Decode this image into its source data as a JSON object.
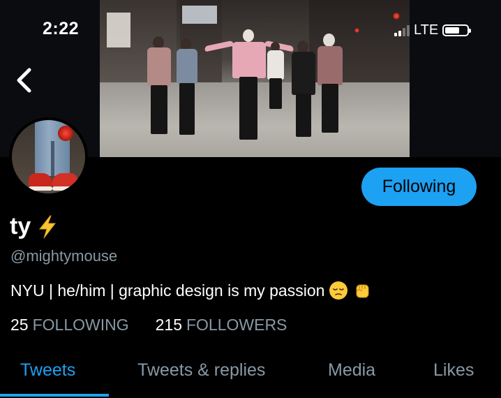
{
  "status_bar": {
    "time": "2:22",
    "network": "LTE",
    "signal_bars": 4,
    "signal_bars_active": 2
  },
  "nav": {
    "back_icon": "chevron-left-icon"
  },
  "profile": {
    "display_name": "ty",
    "name_emoji": "lightning-bolt",
    "handle": "@mightymouse",
    "bio": "NYU | he/him | graphic design is my passion",
    "bio_emojis": [
      "pensive-face",
      "raised-fist"
    ],
    "following_count": "25",
    "following_label": "FOLLOWING",
    "followers_count": "215",
    "followers_label": "FOLLOWERS",
    "follow_button_label": "Following"
  },
  "tabs": [
    {
      "label": "Tweets",
      "active": true
    },
    {
      "label": "Tweets & replies",
      "active": false
    },
    {
      "label": "Media",
      "active": false
    },
    {
      "label": "Likes",
      "active": false
    }
  ],
  "colors": {
    "accent": "#1da1f2",
    "background": "#000000",
    "secondary_text": "#8899a6"
  }
}
